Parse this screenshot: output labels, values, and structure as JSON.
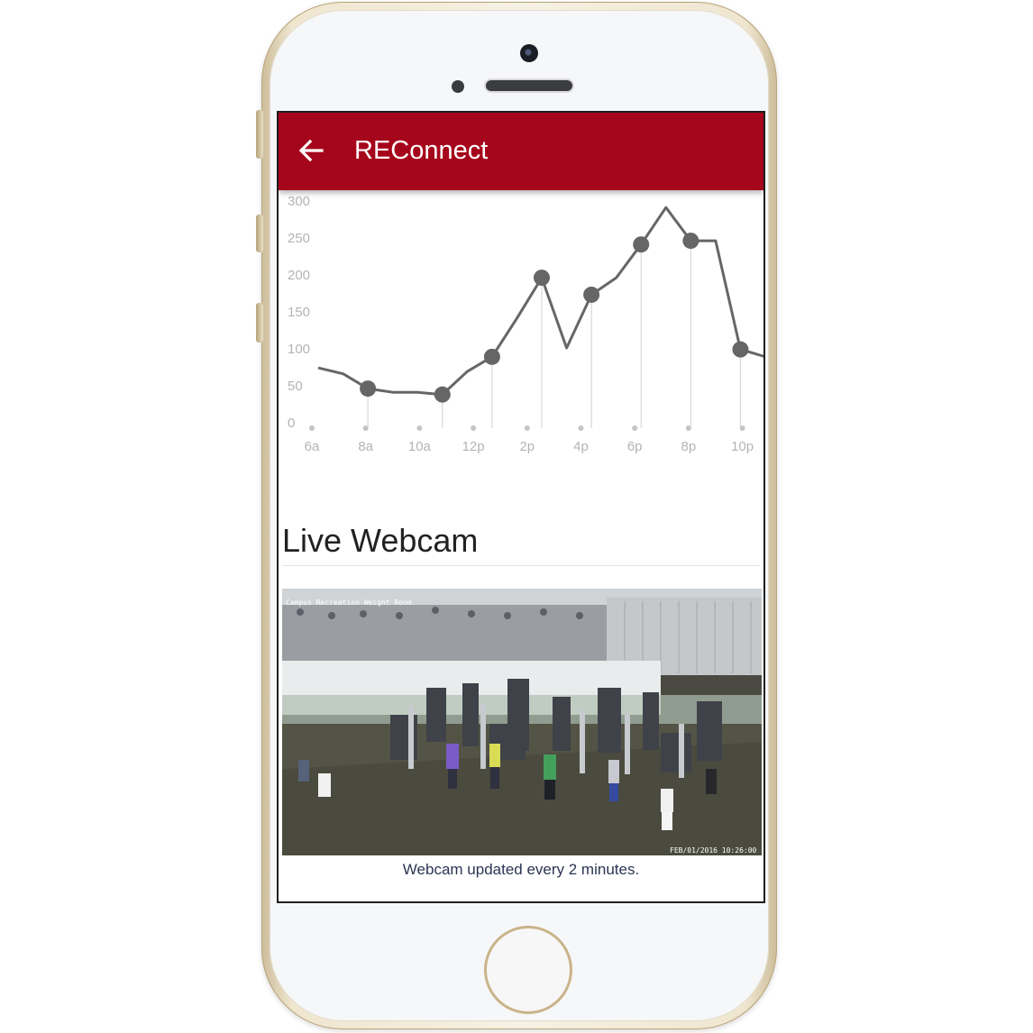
{
  "app": {
    "title": "REConnect"
  },
  "icons": {
    "back": "arrow-left-icon"
  },
  "chart_data": {
    "type": "line",
    "x_labels": [
      "6a",
      "8a",
      "10a",
      "12p",
      "2p",
      "4p",
      "6p",
      "8p",
      "10p"
    ],
    "y_ticks": [
      "300",
      "250",
      "200",
      "150",
      "100",
      "50",
      "0"
    ],
    "ylim": [
      0,
      300
    ],
    "series": [
      {
        "values": [
          73,
          65,
          45,
          40,
          40,
          37,
          68,
          88,
          140,
          195,
          100,
          172,
          195,
          240,
          290,
          245,
          245,
          98,
          88
        ],
        "marker_indices": [
          2,
          5,
          7,
          9,
          11,
          13,
          15,
          17
        ]
      }
    ],
    "xlabel": "",
    "ylabel": ""
  },
  "webcam": {
    "section_title": "Live Webcam",
    "overlay_label": "Campus Recreation Weight Room",
    "timestamp": "FEB/01/2016 10:26:00",
    "caption": "Webcam updated every 2 minutes."
  },
  "colors": {
    "appbar": "#a6061b",
    "line": "#666666",
    "axis_text": "#b4b4b4"
  }
}
